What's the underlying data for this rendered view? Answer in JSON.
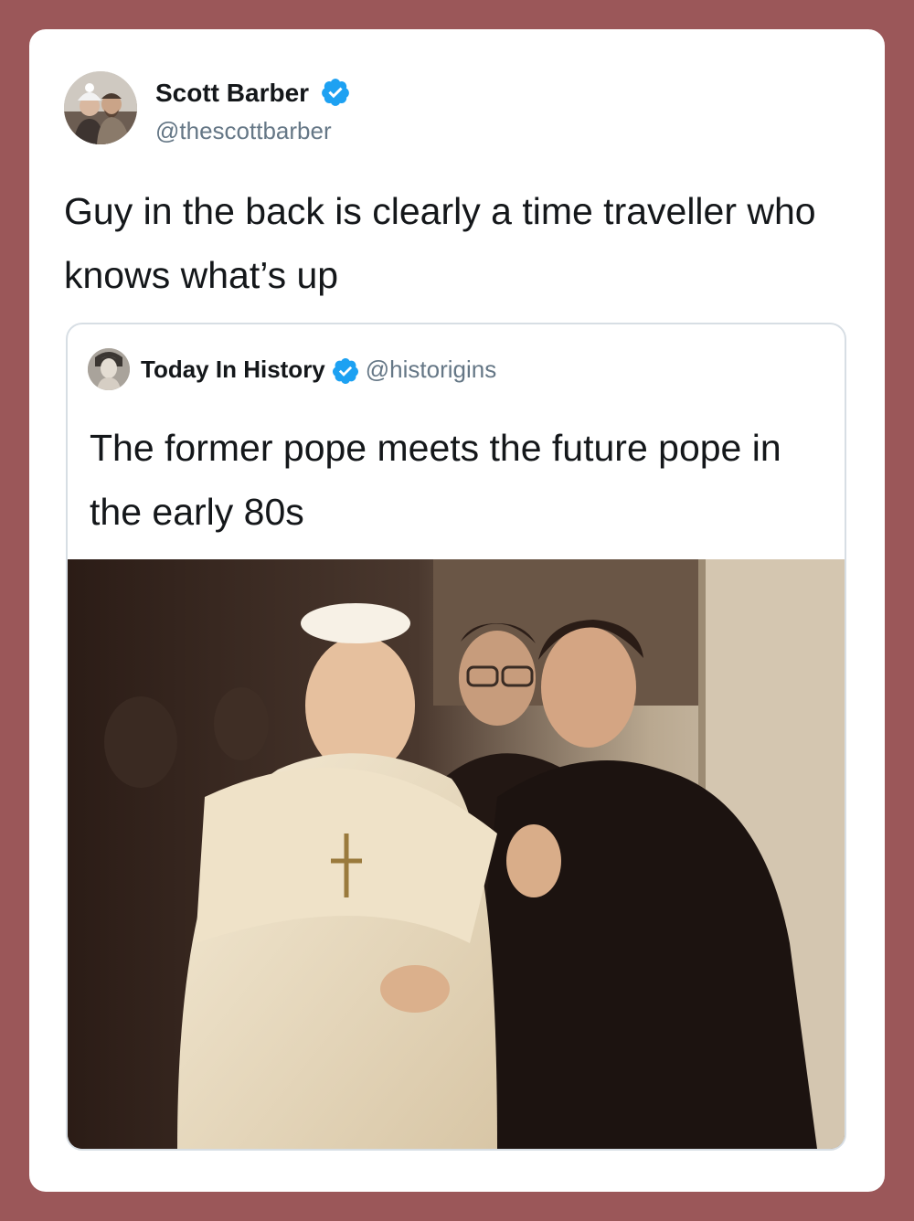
{
  "tweet": {
    "author": {
      "name": "Scott Barber",
      "handle": "@thescottbarber",
      "verified": true,
      "avatar_icon": "profile-photo-couple"
    },
    "text": "Guy in the back is clearly a time traveller who knows what’s up"
  },
  "quoted_tweet": {
    "author": {
      "name": "Today In History",
      "handle": "@historigins",
      "verified": true,
      "avatar_icon": "profile-photo-statue"
    },
    "text": "The former pope meets the future pope in the early 80s",
    "media_icon": "photo-pope-meeting"
  },
  "colors": {
    "background": "#9b5759",
    "card": "#ffffff",
    "verified_badge": "#1da1f2",
    "text_primary": "#14171a",
    "text_secondary": "#657786",
    "quote_border": "#d7dee4"
  }
}
